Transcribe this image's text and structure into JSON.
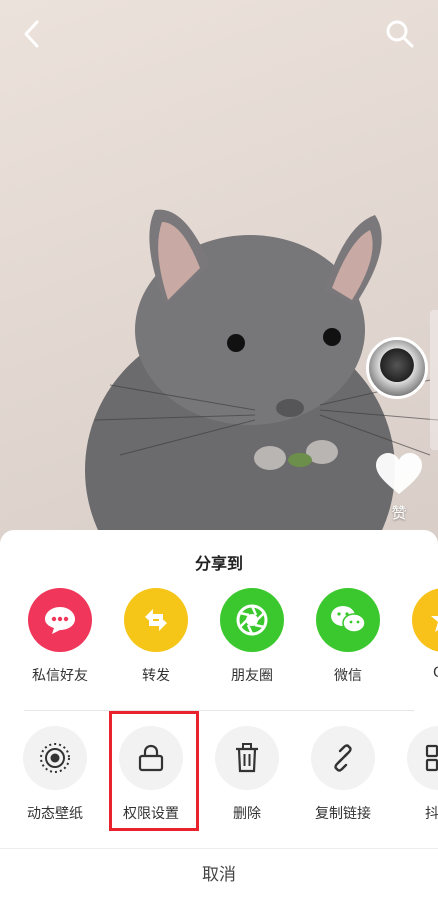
{
  "header": {
    "back_icon": "chevron-left-icon",
    "search_icon": "search-icon"
  },
  "side": {
    "like_label": "赞"
  },
  "share_sheet": {
    "title": "分享到",
    "row1": [
      {
        "label": "私信好友",
        "icon": "chat-bubble-icon",
        "color": "#f0375b"
      },
      {
        "label": "转发",
        "icon": "repost-icon",
        "color": "#f5c518"
      },
      {
        "label": "朋友圈",
        "icon": "moments-shutter-icon",
        "color": "#3bc82e"
      },
      {
        "label": "微信",
        "icon": "wechat-icon",
        "color": "#3bc82e"
      },
      {
        "label": "QQ",
        "icon": "qq-star-icon",
        "color": "#f9c21a"
      }
    ],
    "row2": [
      {
        "label": "动态壁纸",
        "icon": "live-wallpaper-icon"
      },
      {
        "label": "权限设置",
        "icon": "lock-icon"
      },
      {
        "label": "删除",
        "icon": "trash-icon"
      },
      {
        "label": "复制链接",
        "icon": "link-icon"
      },
      {
        "label": "抖音",
        "icon": "grid-icon"
      }
    ],
    "cancel_label": "取消"
  }
}
